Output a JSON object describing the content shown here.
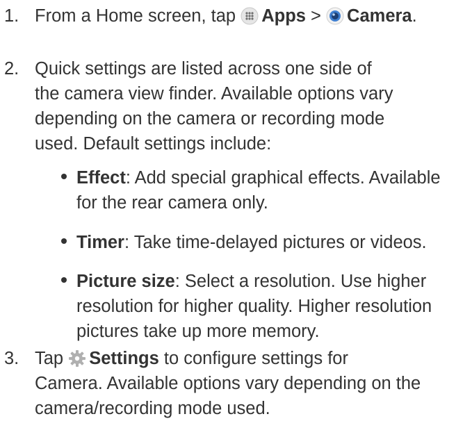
{
  "steps": [
    {
      "number": "1.",
      "pre": "From a Home screen, tap",
      "apps_label": "Apps",
      "separator": ">",
      "camera_label": "Camera",
      "end": "."
    },
    {
      "number": "2.",
      "lines": [
        "Quick settings are listed across one side of",
        "the camera view finder. Available options vary",
        "depending on the camera or recording mode",
        "used. Default settings include:"
      ],
      "bullets": [
        {
          "term": "Effect",
          "lines": [
            ": Add special graphical effects. Available",
            "for the rear camera only."
          ]
        },
        {
          "term": "Timer",
          "lines": [
            ": Take time-delayed pictures or videos."
          ]
        },
        {
          "term": "Picture size",
          "lines": [
            ": Select a resolution. Use higher",
            "resolution for higher quality. Higher resolution",
            "pictures take up more memory."
          ]
        }
      ]
    },
    {
      "number": "3.",
      "pre": "Tap",
      "settings_label": "Settings",
      "line1_rest": " to configure settings for",
      "lines": [
        "Camera. Available options vary depending on the",
        "camera/recording mode used."
      ]
    }
  ],
  "icons": {
    "apps": "apps-grid-icon",
    "camera": "camera-lens-icon",
    "settings": "gear-icon"
  },
  "colors": {
    "text": "#333333",
    "apps_icon_bg": "#dcdcdc",
    "camera_icon_blue": "#3f7fd0",
    "settings_icon": "#b0b0b0"
  }
}
